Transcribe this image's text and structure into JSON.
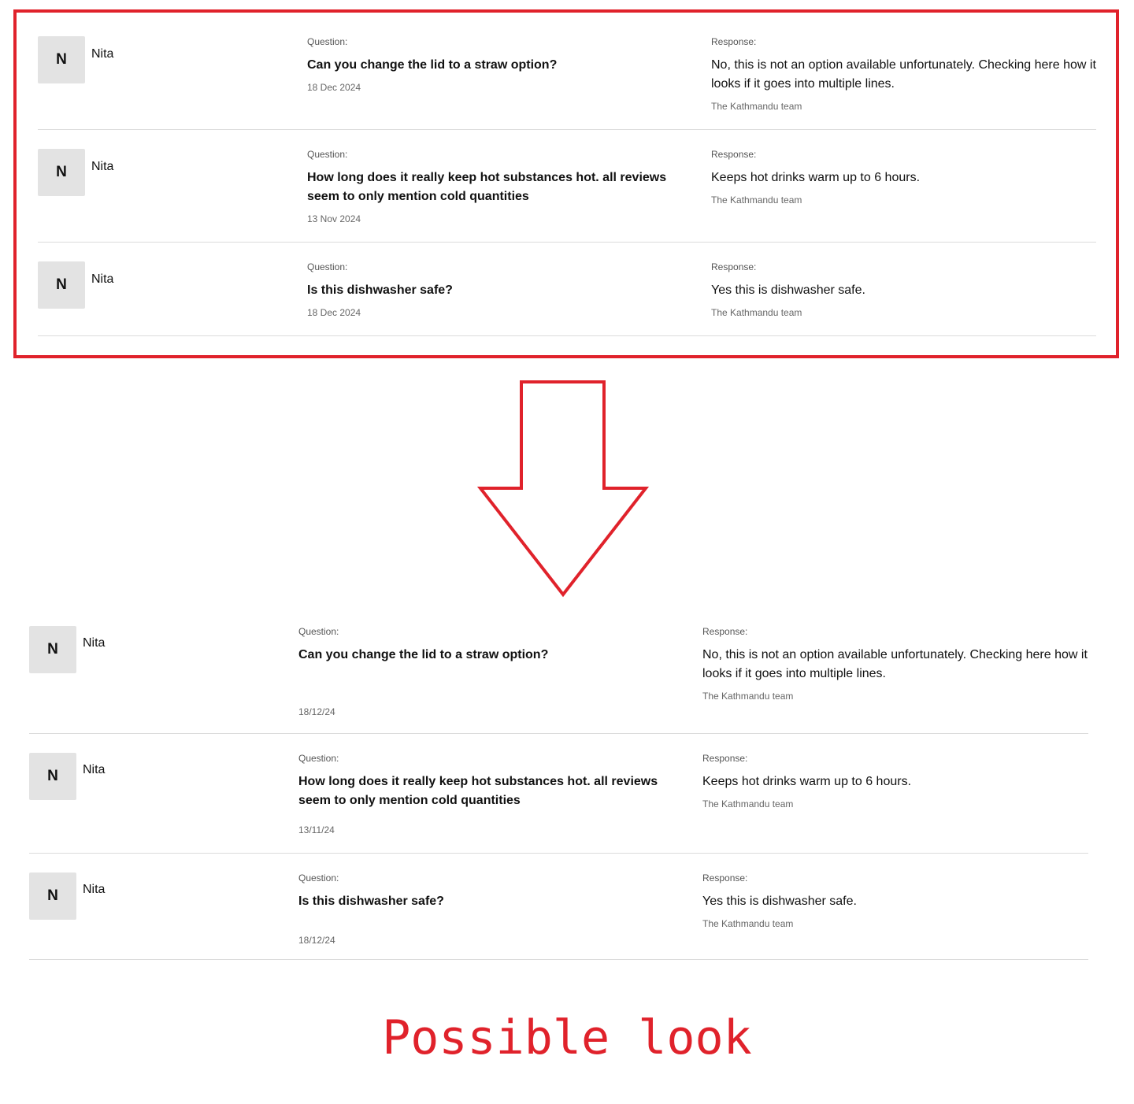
{
  "labels": {
    "question": "Question:",
    "response": "Response:"
  },
  "current": {
    "items": [
      {
        "avatar": "N",
        "author": "Nita",
        "question": "Can you change the lid to a straw option?",
        "date": "18 Dec 2024",
        "response": "No, this is not an option available unfortunately. Checking here how it looks if it goes into multiple lines.",
        "team": "The Kathmandu team"
      },
      {
        "avatar": "N",
        "author": "Nita",
        "question": "How long does it really keep hot substances hot. all reviews seem to only mention cold quantities",
        "date": "13 Nov 2024",
        "response": "Keeps hot drinks warm up to 6 hours.",
        "team": "The Kathmandu team"
      },
      {
        "avatar": "N",
        "author": "Nita",
        "question": "Is this dishwasher safe?",
        "date": "18 Dec 2024",
        "response": "Yes this is dishwasher safe.",
        "team": "The Kathmandu team"
      }
    ]
  },
  "proposed": {
    "items": [
      {
        "avatar": "N",
        "author": "Nita",
        "question": "Can you change the lid to a straw option?",
        "date": "18/12/24",
        "response": "No, this is not an option available unfortunately. Checking here how it looks if it goes into multiple lines.",
        "team": "The Kathmandu team"
      },
      {
        "avatar": "N",
        "author": "Nita",
        "question": "How long does it really keep hot substances hot. all reviews seem to only mention cold quantities",
        "date": "13/11/24",
        "response": "Keeps hot drinks warm up to 6 hours.",
        "team": "The Kathmandu team"
      },
      {
        "avatar": "N",
        "author": "Nita",
        "question": "Is this dishwasher safe?",
        "date": "18/12/24",
        "response": "Yes this is dishwasher safe.",
        "team": "The Kathmandu team"
      }
    ]
  },
  "caption": "Possible look",
  "colors": {
    "annotation": "#e0222b",
    "avatar_bg": "#e3e3e3",
    "divider": "#dcdcdc"
  },
  "icons": {
    "arrow": "down-arrow-icon"
  }
}
